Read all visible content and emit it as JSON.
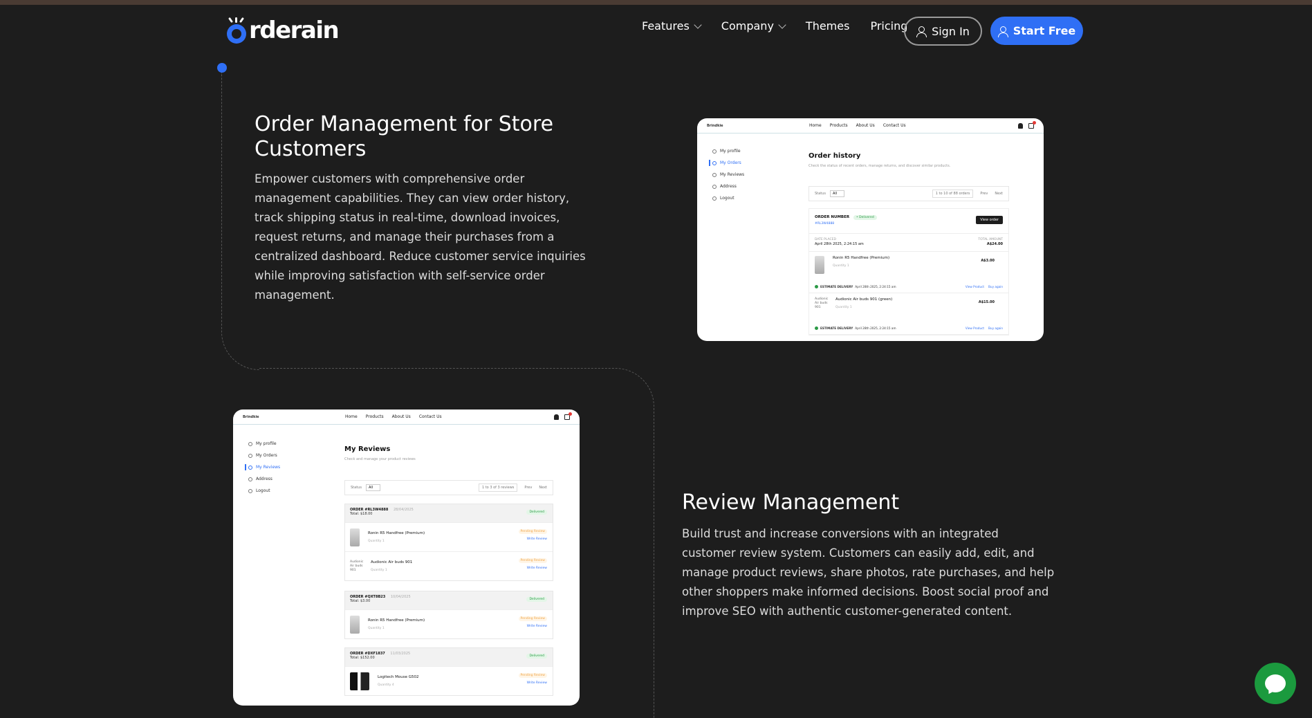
{
  "brand": {
    "name": "rderain"
  },
  "nav": {
    "features": "Features",
    "company": "Company",
    "themes": "Themes",
    "pricing": "Pricing",
    "sign_in": "Sign In",
    "start_free": "Start Free"
  },
  "section1": {
    "title": "Order Management for Store Customers",
    "body": "Empower customers with comprehensive order management capabilities. They can view order history, track shipping status in real-time, download invoices, request returns, and manage their purchases from a centralized dashboard. Reduce customer service inquiries while improving satisfaction with self-service order management."
  },
  "section2": {
    "title": "Review Management",
    "body": "Build trust and increase conversions with an integrated customer review system. Customers can easily add, edit, and manage product reviews, share photos, rate purchases, and help other shoppers make informed decisions. Boost social proof and improve SEO with authentic customer-generated content."
  },
  "mock_common": {
    "logo": "Brindkie",
    "links": [
      "Home",
      "Products",
      "About Us",
      "Contact Us"
    ],
    "sidebar": [
      "My profile",
      "My Orders",
      "My Reviews",
      "Address",
      "Logout"
    ]
  },
  "order_mock": {
    "title": "Order history",
    "subtitle": "Check the status of recent orders, manage returns, and discover similar products.",
    "filter_label": "Status",
    "filter_value": "All",
    "count": "1 to 10 of 88 orders",
    "prev": "Prev",
    "next": "Next",
    "order_number_label": "ORDER NUMBER",
    "order_status": "• Delivered",
    "order_link": "#RL3W4888",
    "view_order": "View order",
    "date_label": "DATE PLACED",
    "date_value": "April 28th 2025, 2:24:15 am",
    "total_label": "TOTAL AMOUNT",
    "total_value": "A$24.00",
    "items": [
      {
        "name": "Ronin R5 Handfree (Premium)",
        "qty": "Quantity 1",
        "price": "A$3.00",
        "thumb": ""
      },
      {
        "name": "Audionic Air buds 901 (green)",
        "qty": "Quantity 1",
        "price": "A$15.00",
        "thumb": "Audionic Air buds 901"
      }
    ],
    "estimate_label": "ESTIMATE DELIVERY",
    "estimate_value": "April 28th 2025, 2:24:15 am",
    "view_product": "View Product",
    "buy_again": "Buy again"
  },
  "review_mock": {
    "title": "My Reviews",
    "subtitle": "Check and manage your product reviews",
    "filter_label": "Status",
    "filter_value": "All",
    "count": "1 to 3 of 3 reviews",
    "prev": "Prev",
    "next": "Next",
    "delivered": "Delivered",
    "pending": "Pending Review",
    "write": "Write Review",
    "orders": [
      {
        "num": "ORDER #RL3W4888",
        "date": "28/04/2025",
        "total": "Total: $18.00",
        "items": [
          {
            "name": "Ronin R5 Handfree (Premium)",
            "qty": "Quantity 1",
            "thumb": ""
          },
          {
            "name": "Audionic Air buds 901",
            "qty": "Quantity 1",
            "thumb": "Audionic Air buds 901"
          }
        ]
      },
      {
        "num": "ORDER #QXT8B23",
        "date": "10/04/2025",
        "total": "Total: $3.00",
        "items": [
          {
            "name": "Ronin R5 Handfree (Premium)",
            "qty": "Quantity 1",
            "thumb": ""
          }
        ]
      },
      {
        "num": "ORDER #DXF1837",
        "date": "11/03/2025",
        "total": "Total: $152.00",
        "items": [
          {
            "name": "Logitech Mouse G502",
            "qty": "Quantity 4",
            "thumb": ""
          }
        ]
      }
    ]
  },
  "colors": {
    "accent": "#2f6ff5",
    "background": "#1d1d1d",
    "chat": "#1b9a3e"
  }
}
